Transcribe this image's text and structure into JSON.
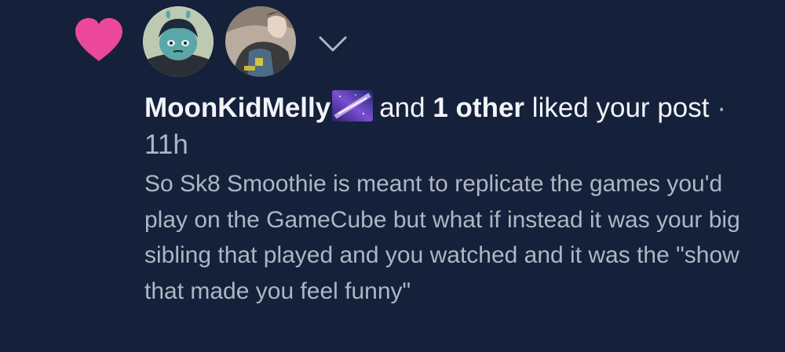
{
  "notification": {
    "liker_name": "MoonKidMelly",
    "liker_emoji": "galaxy-emoji",
    "conjunction": "and",
    "others_text": "1 other",
    "action_text": "liked your",
    "object_text": "post",
    "separator": "·",
    "time_ago": "11h",
    "post_excerpt": "So Sk8 Smoothie is meant to replicate the games you'd play on the GameCube but what if instead it was your big sibling that played and you watched and it was the \"show that made you feel funny\"",
    "icons": {
      "like": "heart-icon",
      "expand": "chevron-down-icon"
    },
    "colors": {
      "background": "#15213a",
      "heart": "#ec4899",
      "primary_text": "#f2f4f8",
      "secondary_text": "#aeb6c4"
    }
  }
}
